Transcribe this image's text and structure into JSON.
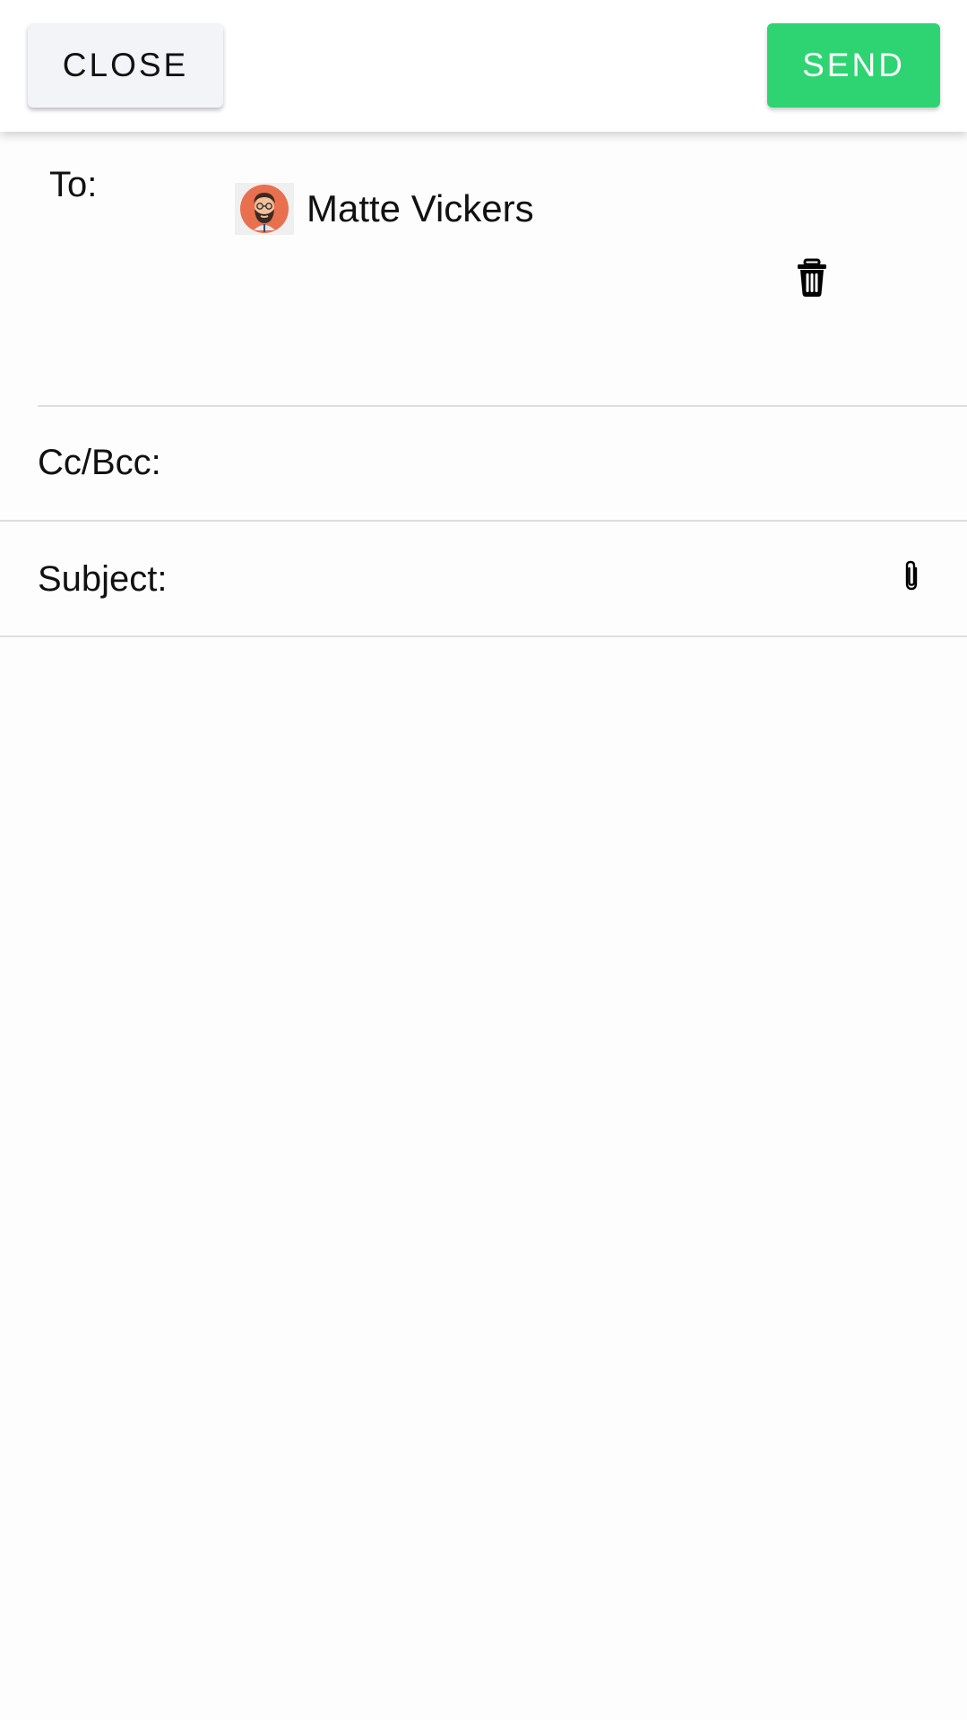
{
  "header": {
    "close_label": "Close",
    "send_label": "Send",
    "send_color": "#2fd472"
  },
  "to": {
    "label": "To:",
    "recipients": [
      {
        "name": "Matte Vickers",
        "avatar_icon": "bearded-man-avatar"
      }
    ],
    "input_value": ""
  },
  "cc_bcc": {
    "label": "Cc/Bcc:",
    "value": ""
  },
  "subject": {
    "label": "Subject:",
    "value": ""
  },
  "body": {
    "value": ""
  },
  "icons": {
    "delete": "trash-icon",
    "attach": "paperclip-icon"
  }
}
